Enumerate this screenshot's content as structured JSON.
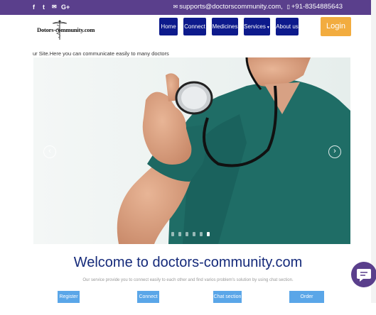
{
  "topbar": {
    "social": [
      {
        "icon": "facebook-icon",
        "glyph": "f"
      },
      {
        "icon": "twitter-icon",
        "glyph": "t"
      },
      {
        "icon": "mail-icon",
        "glyph": "✉"
      },
      {
        "icon": "googleplus-icon",
        "glyph": "G+"
      }
    ],
    "email": "supports@doctorscommunity.com,",
    "phone": "+91-8354885643"
  },
  "header": {
    "logo_text": "Dotors-community.com",
    "nav": [
      "Home",
      "Connect",
      "Medicines",
      "Services",
      "About us"
    ],
    "login": "Login"
  },
  "marquee": "ur Site.Here you can communicate easily to many doctors",
  "slider": {
    "prev_glyph": "‹",
    "next_glyph": "›",
    "slide_count": 6,
    "active_index": 5
  },
  "welcome": {
    "title": "Welcome to doctors-community.com",
    "description": "Our service provide you to connect easily to each other and find varios problem's solution by using chat section.",
    "buttons": [
      "Register",
      "Connect",
      "Chat section",
      "Order Medicines"
    ]
  },
  "colors": {
    "topbar": "#5a3f8c",
    "nav": "#0d1a8c",
    "login": "#f2ac3f",
    "bottom_buttons": "#5aa6e8",
    "heading": "#152a7a"
  }
}
